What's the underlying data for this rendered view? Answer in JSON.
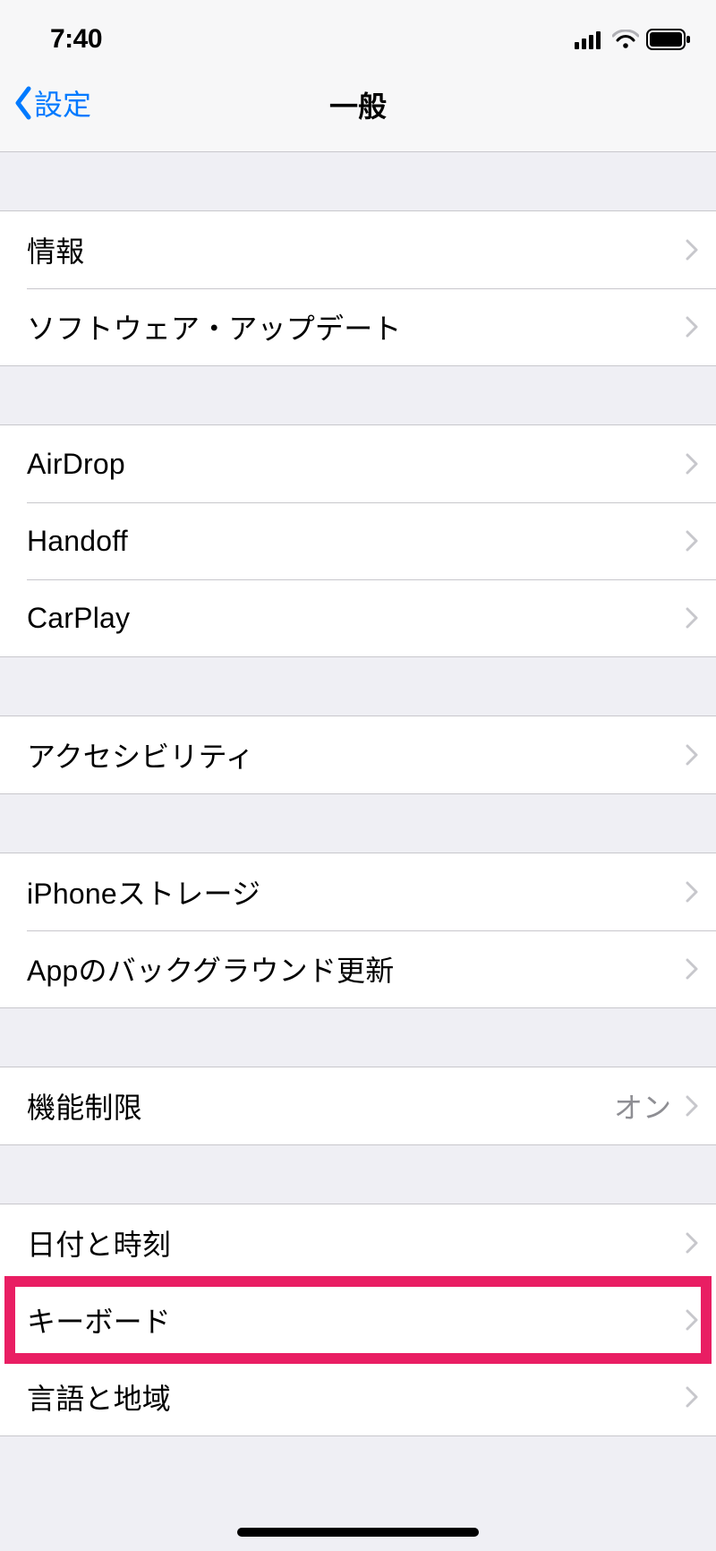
{
  "statusBar": {
    "time": "7:40"
  },
  "navBar": {
    "backLabel": "設定",
    "title": "一般"
  },
  "groups": [
    {
      "rows": [
        {
          "label": "情報"
        },
        {
          "label": "ソフトウェア・アップデート"
        }
      ]
    },
    {
      "rows": [
        {
          "label": "AirDrop"
        },
        {
          "label": "Handoff"
        },
        {
          "label": "CarPlay"
        }
      ]
    },
    {
      "rows": [
        {
          "label": "アクセシビリティ"
        }
      ]
    },
    {
      "rows": [
        {
          "label": "iPhoneストレージ"
        },
        {
          "label": "Appのバックグラウンド更新"
        }
      ]
    },
    {
      "rows": [
        {
          "label": "機能制限",
          "value": "オン"
        }
      ]
    },
    {
      "rows": [
        {
          "label": "日付と時刻"
        },
        {
          "label": "キーボード",
          "highlighted": true
        },
        {
          "label": "言語と地域"
        }
      ]
    }
  ]
}
